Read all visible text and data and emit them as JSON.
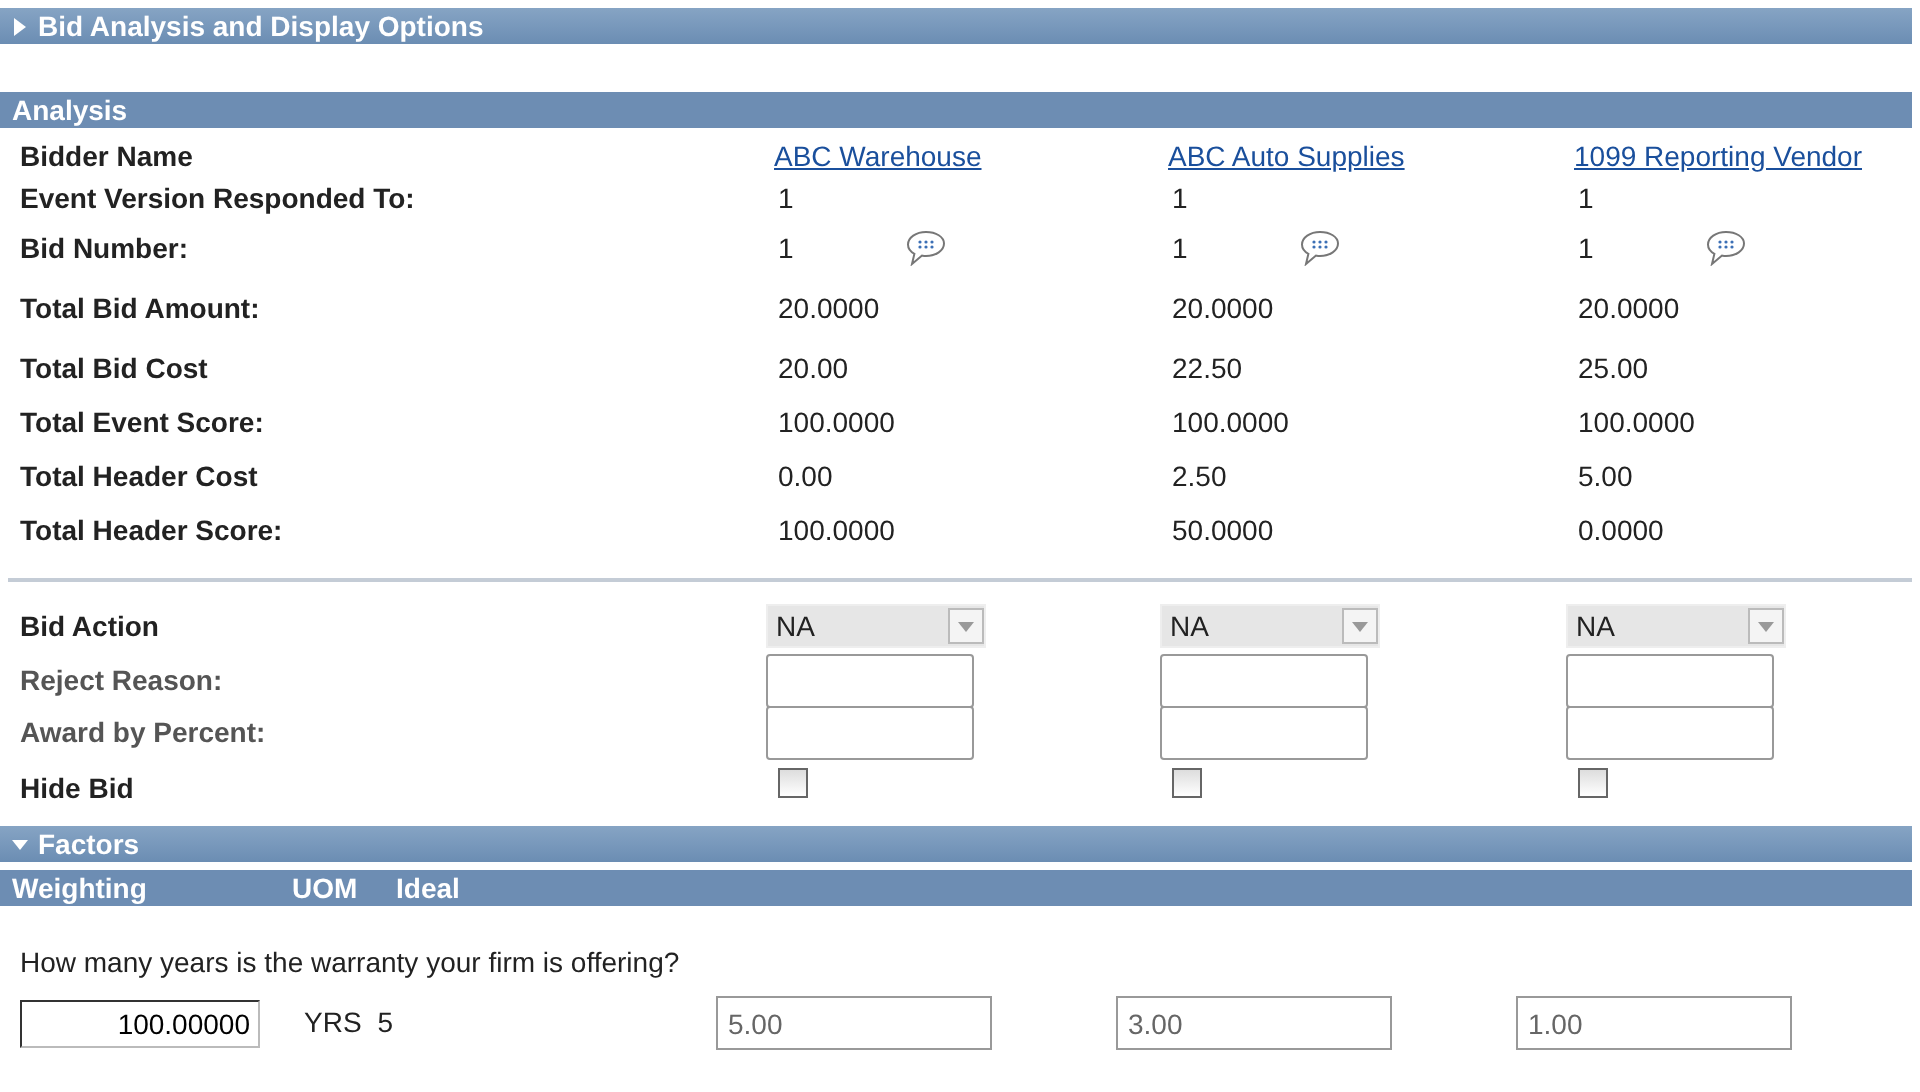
{
  "display_options": {
    "title": "Bid Analysis and Display Options",
    "expanded": false
  },
  "analysis": {
    "title": "Analysis",
    "bidder_label": "Bidder Name",
    "bidders": [
      {
        "name": "ABC Warehouse"
      },
      {
        "name": "ABC Auto Supplies"
      },
      {
        "name": "1099 Reporting Vendor"
      }
    ],
    "rows": [
      {
        "label": "Event Version Responded To:",
        "kind": "text",
        "values": [
          "1",
          "1",
          "1"
        ]
      },
      {
        "label": "Bid Number:",
        "kind": "comment",
        "values": [
          "1",
          "1",
          "1"
        ]
      },
      {
        "label": "Total Bid Amount:",
        "kind": "text",
        "values": [
          "20.0000",
          "20.0000",
          "20.0000"
        ]
      },
      {
        "label": "Total Bid Cost",
        "kind": "text",
        "values": [
          "20.00",
          "22.50",
          "25.00"
        ]
      },
      {
        "label": "Total Event Score:",
        "kind": "text",
        "values": [
          "100.0000",
          "100.0000",
          "100.0000"
        ]
      },
      {
        "label": "Total Header Cost",
        "kind": "text",
        "values": [
          "0.00",
          "2.50",
          "5.00"
        ]
      },
      {
        "label": "Total Header Score:",
        "kind": "text",
        "values": [
          "100.0000",
          "50.0000",
          "0.0000"
        ]
      }
    ],
    "actions": [
      {
        "label": "Bid Action",
        "kind": "select",
        "values": [
          "NA",
          "NA",
          "NA"
        ]
      },
      {
        "label": "Reject Reason:",
        "kind": "input"
      },
      {
        "label": "Award by Percent:",
        "kind": "input"
      },
      {
        "label": "Hide Bid",
        "kind": "checkbox",
        "checked": [
          false,
          false,
          false
        ]
      }
    ]
  },
  "factors": {
    "title": "Factors",
    "expanded": true,
    "columns": [
      "Weighting",
      "UOM",
      "Ideal"
    ],
    "items": [
      {
        "question": "How many years is the warranty your firm is offering?",
        "weighting": "100.00000",
        "uom": "YRS",
        "ideal": "5",
        "responses": [
          {
            "value": "5.00",
            "disabled": true
          },
          {
            "value": "3.00",
            "disabled": true
          },
          {
            "value": "1.00",
            "disabled": true
          }
        ]
      }
    ]
  }
}
